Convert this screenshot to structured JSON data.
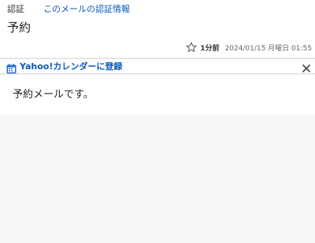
{
  "header": {
    "auth_label": "認証",
    "auth_link": "このメールの認証情報",
    "subject": "予約",
    "relative_time": "1分前",
    "absolute_time": "2024/01/15 月曜日 01:55"
  },
  "calendar_bar": {
    "label": "Yahoo!カレンダーに登録"
  },
  "message": {
    "body": "予約メールです。"
  },
  "icons": {
    "star": "star-outline-icon",
    "calendar": "calendar-icon",
    "close": "close-icon"
  },
  "colors": {
    "link": "#0b58b5",
    "background": "#f7f7f7"
  }
}
